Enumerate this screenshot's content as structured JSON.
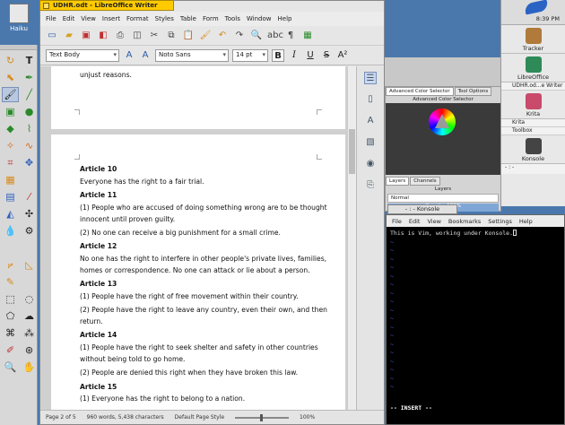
{
  "desktop": {
    "haiku_label": "Haiku"
  },
  "libreoffice": {
    "title": "UDHR.odt - LibreOffice Writer",
    "menu": [
      "File",
      "Edit",
      "View",
      "Insert",
      "Format",
      "Styles",
      "Table",
      "Form",
      "Tools",
      "Window",
      "Help"
    ],
    "paragraph_style": "Text Body",
    "font_name": "Noto Sans",
    "font_size": "14 pt",
    "page1_tail": "unjust reasons.",
    "articles": [
      {
        "heading": "Article 10",
        "paras": [
          "Everyone has the right to a fair trial."
        ]
      },
      {
        "heading": "Article 11",
        "paras": [
          "(1) People who are accused of doing something wrong are to be thought innocent until proven guilty.",
          "(2) No one can receive a big punishment for a small crime."
        ]
      },
      {
        "heading": "Article 12",
        "paras": [
          "No one has the right to interfere in other people's private lives, families, homes or correspondence. No one can attack or lie about a person."
        ]
      },
      {
        "heading": "Article 13",
        "paras": [
          "(1) People have the right of free movement within their country.",
          "(2) People have the right to leave any country, even their own, and then return."
        ]
      },
      {
        "heading": "Article 14",
        "paras": [
          "(1) People have the right to seek shelter and safety in other countries without being told to go home.",
          "(2) People are denied this right when they have broken this law."
        ]
      },
      {
        "heading": "Article 15",
        "paras": [
          "(1) Everyone has the right to belong to a nation."
        ]
      }
    ],
    "status": {
      "page": "Page 2 of 5",
      "words": "960 words, 5,438 characters",
      "page_style": "Default Page Style",
      "zoom": "100%"
    }
  },
  "krita_docker": {
    "tabs": [
      "Advanced Color Selector",
      "Tool Options"
    ],
    "subheader": "Advanced Color Selector",
    "layer_tabs": [
      "Layers",
      "Channels"
    ],
    "layers_title": "Layers",
    "blend_mode": "Normal",
    "opacity": "Opacity: 100%"
  },
  "konsole": {
    "title": "- : - Konsole",
    "menu": [
      "File",
      "Edit",
      "View",
      "Bookmarks",
      "Settings",
      "Help"
    ],
    "first_line": "This is Vim, working under Konsole.",
    "tilde": "~",
    "mode": "-- INSERT --"
  },
  "deskbar": {
    "clock": "8:39 PM",
    "apps": [
      {
        "name": "Tracker",
        "color": "#b07a3a"
      },
      {
        "name": "LibreOffice",
        "color": "#2e8b57"
      },
      {
        "name": "Krita",
        "color": "#c94a6a"
      },
      {
        "name": "Konsole",
        "color": "#444444"
      }
    ],
    "lo_window": "UDHR.od...e Writer",
    "krita_windows": [
      "Krita",
      "Toolbox"
    ],
    "konsole_window": "- : -"
  }
}
